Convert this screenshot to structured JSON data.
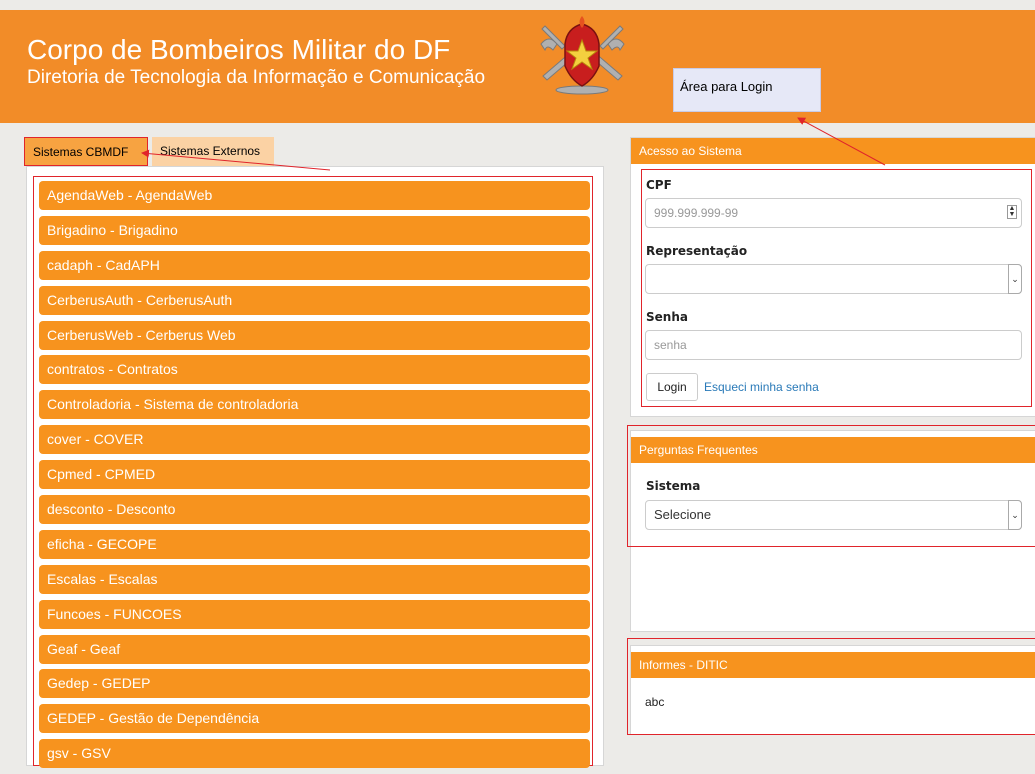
{
  "header": {
    "title": "Corpo de Bombeiros Militar do DF",
    "subtitle": "Diretoria de Tecnologia da Informação e Comunicação"
  },
  "annotation": {
    "note": "Área para Login"
  },
  "tabs": [
    {
      "label": "Sistemas CBMDF",
      "active": true
    },
    {
      "label": "Sistemas Externos",
      "active": false
    }
  ],
  "systems": [
    "AgendaWeb - AgendaWeb",
    "Brigadino - Brigadino",
    "cadaph - CadAPH",
    "CerberusAuth - CerberusAuth",
    "CerberusWeb - Cerberus Web",
    "contratos - Contratos",
    "Controladoria - Sistema de controladoria",
    "cover - COVER",
    "Cpmed - CPMED",
    "desconto - Desconto",
    "eficha - GECOPE",
    "Escalas - Escalas",
    "Funcoes - FUNCOES",
    "Geaf - Geaf",
    "Gedep - GEDEP",
    "GEDEP - Gestão de Dependência",
    "gsv - GSV"
  ],
  "login": {
    "heading": "Acesso ao Sistema",
    "cpf_label": "CPF",
    "cpf_placeholder": "999.999.999-99",
    "representacao_label": "Representação",
    "representacao_value": "",
    "senha_label": "Senha",
    "senha_placeholder": "senha",
    "login_button": "Login",
    "forgot_link": "Esqueci minha senha"
  },
  "faq": {
    "heading": "Perguntas Frequentes",
    "sistema_label": "Sistema",
    "sistema_selected": "Selecione"
  },
  "info": {
    "heading": "Informes - DITIC",
    "text": "abc"
  },
  "colors": {
    "brand": "#f28c28",
    "item": "#f7931e",
    "annotation": "#e0242b"
  },
  "icons": {
    "logo": "firefighter-emblem-icon"
  }
}
